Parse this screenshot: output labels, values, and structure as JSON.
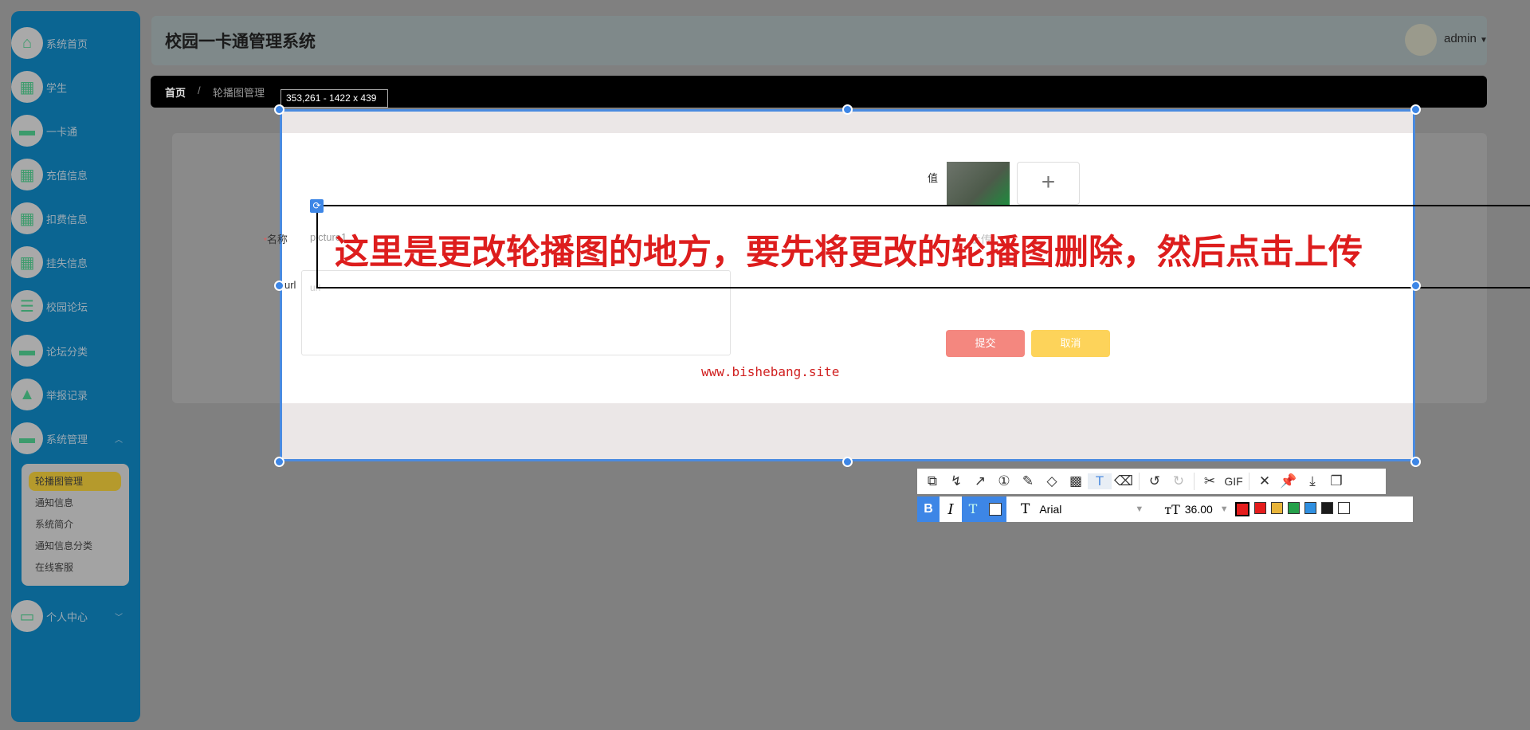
{
  "app": {
    "title": "校园一卡通管理系统",
    "user": "admin"
  },
  "sidebar": {
    "items": [
      {
        "label": "系统首页",
        "icon": "⌂"
      },
      {
        "label": "学生",
        "icon": "▦"
      },
      {
        "label": "一卡通",
        "icon": "▬"
      },
      {
        "label": "充值信息",
        "icon": "▦"
      },
      {
        "label": "扣费信息",
        "icon": "▦"
      },
      {
        "label": "挂失信息",
        "icon": "▦"
      },
      {
        "label": "校园论坛",
        "icon": "☰"
      },
      {
        "label": "论坛分类",
        "icon": "▬"
      },
      {
        "label": "举报记录",
        "icon": "▲"
      },
      {
        "label": "系统管理",
        "icon": "▬"
      }
    ],
    "submenu": [
      "轮播图管理",
      "通知信息",
      "系统简介",
      "通知信息分类",
      "在线客服"
    ],
    "personal": "个人中心"
  },
  "breadcrumb": {
    "home": "首页",
    "sep": "/",
    "current": "轮播图管理"
  },
  "capture": {
    "size_label": "353,261 - 1422 x 439"
  },
  "form": {
    "value_label": "值",
    "name_label": "名称",
    "name_required": "*",
    "name_value": "picture1",
    "upload_label": "上传",
    "url_label": "url",
    "url_placeholder": "url",
    "submit": "提交",
    "cancel": "取消"
  },
  "annotation": {
    "text": "这里是更改轮播图的地方，要先将更改的轮播图删除，然后点击上传"
  },
  "watermark": "www.bishebang.site",
  "toolbar": {
    "gif": "GIF",
    "font": "Arial",
    "size": "36.00",
    "bold": "B",
    "italic": "I",
    "colors": [
      "#e51c1c",
      "#e51c1c",
      "#e8b43a",
      "#25a04a",
      "#2f8fe0",
      "#1b1b1b",
      "#ffffff"
    ]
  }
}
